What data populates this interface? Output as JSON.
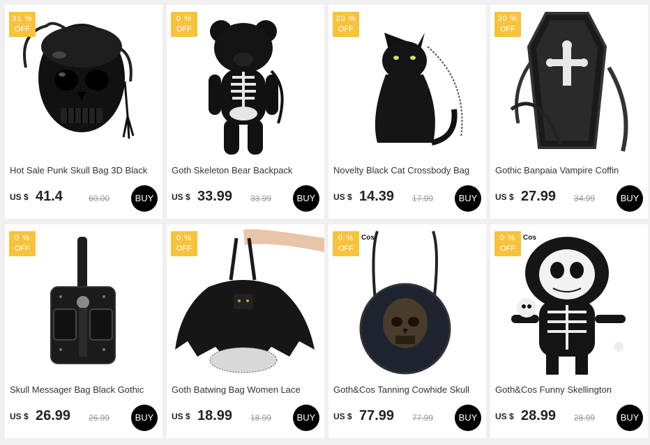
{
  "currency": "US $",
  "buy_label": "BUY",
  "badge_off": "OFF",
  "products": [
    {
      "title": "Hot Sale Punk Skull Bag 3D Black",
      "discount": "31 %",
      "price": "41.4",
      "old_price": "60.00",
      "brand_tag": ""
    },
    {
      "title": "Goth Skeleton Bear Backpack",
      "discount": "0 %",
      "price": "33.99",
      "old_price": "33.99",
      "brand_tag": ""
    },
    {
      "title": "Novelty Black Cat Crossbody Bag",
      "discount": "20 %",
      "price": "14.39",
      "old_price": "17.99",
      "brand_tag": ""
    },
    {
      "title": "Gothic Banpaia Vampire Coffin",
      "discount": "20 %",
      "price": "27.99",
      "old_price": "34.99",
      "brand_tag": ""
    },
    {
      "title": "Skull Messager Bag Black Gothic",
      "discount": "0 %",
      "price": "26.99",
      "old_price": "26.99",
      "brand_tag": ""
    },
    {
      "title": "Goth Batwing Bag Women Lace",
      "discount": "0 %",
      "price": "18.99",
      "old_price": "18.99",
      "brand_tag": ""
    },
    {
      "title": "Goth&Cos Tanning Cowhide Skull",
      "discount": "0 %",
      "price": "77.99",
      "old_price": "77.99",
      "brand_tag": "Cos"
    },
    {
      "title": "Goth&Cos Funny Skellington",
      "discount": "0 %",
      "price": "28.99",
      "old_price": "28.99",
      "brand_tag": "Cos"
    }
  ],
  "colors": {
    "badge": "#f7c33c",
    "buy": "#000000",
    "background": "#f0f0f0"
  },
  "icons": [
    "skull-bag-image",
    "skeleton-bear-image",
    "black-cat-bag-image",
    "coffin-bag-image",
    "skull-messenger-image",
    "batwing-bag-image",
    "round-skull-bag-image",
    "skellington-backpack-image"
  ]
}
